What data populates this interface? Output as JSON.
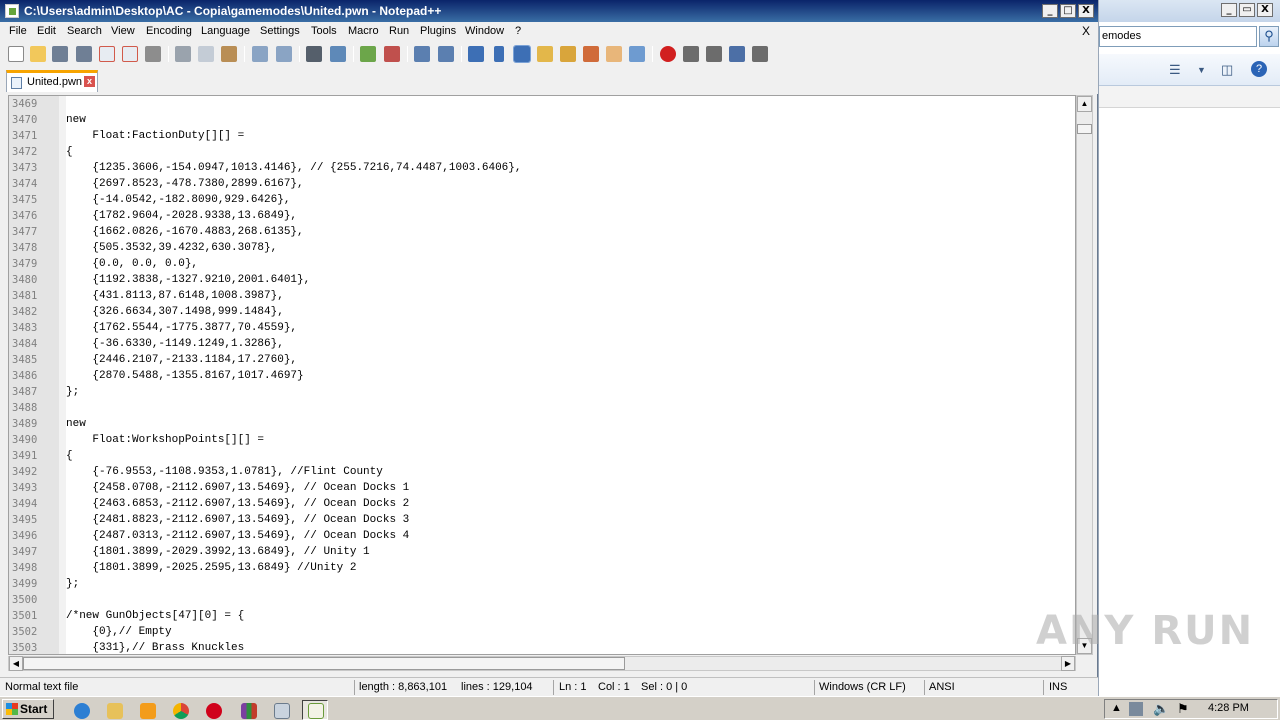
{
  "window": {
    "title": "C:\\Users\\admin\\Desktop\\AC - Copia\\gamemodes\\United.pwn - Notepad++",
    "min_label": "_",
    "max_label": "□",
    "close_label": "X"
  },
  "background_window": {
    "search_value": "emodes",
    "min_label": "_",
    "restore_label": "▭",
    "close_label": "X"
  },
  "menu": {
    "items": [
      "File",
      "Edit",
      "Search",
      "View",
      "Encoding",
      "Language",
      "Settings",
      "Tools",
      "Macro",
      "Run",
      "Plugins",
      "Window",
      "?"
    ],
    "close_label": "X"
  },
  "tab": {
    "label": "United.pwn",
    "close_label": "x"
  },
  "editor": {
    "lines": [
      {
        "n": "3469",
        "t": ""
      },
      {
        "n": "3470",
        "t": "new"
      },
      {
        "n": "3471",
        "t": "    Float:FactionDuty[][] ="
      },
      {
        "n": "3472",
        "t": "{"
      },
      {
        "n": "3473",
        "t": "    {1235.3606,-154.0947,1013.4146}, // {255.7216,74.4487,1003.6406},"
      },
      {
        "n": "3474",
        "t": "    {2697.8523,-478.7380,2899.6167},"
      },
      {
        "n": "3475",
        "t": "    {-14.0542,-182.8090,929.6426},"
      },
      {
        "n": "3476",
        "t": "    {1782.9604,-2028.9338,13.6849},"
      },
      {
        "n": "3477",
        "t": "    {1662.0826,-1670.4883,268.6135},"
      },
      {
        "n": "3478",
        "t": "    {505.3532,39.4232,630.3078},"
      },
      {
        "n": "3479",
        "t": "    {0.0, 0.0, 0.0},"
      },
      {
        "n": "3480",
        "t": "    {1192.3838,-1327.9210,2001.6401},"
      },
      {
        "n": "3481",
        "t": "    {431.8113,87.6148,1008.3987},"
      },
      {
        "n": "3482",
        "t": "    {326.6634,307.1498,999.1484},"
      },
      {
        "n": "3483",
        "t": "    {1762.5544,-1775.3877,70.4559},"
      },
      {
        "n": "3484",
        "t": "    {-36.6330,-1149.1249,1.3286},"
      },
      {
        "n": "3485",
        "t": "    {2446.2107,-2133.1184,17.2760},"
      },
      {
        "n": "3486",
        "t": "    {2870.5488,-1355.8167,1017.4697}"
      },
      {
        "n": "3487",
        "t": "};"
      },
      {
        "n": "3488",
        "t": ""
      },
      {
        "n": "3489",
        "t": "new"
      },
      {
        "n": "3490",
        "t": "    Float:WorkshopPoints[][] ="
      },
      {
        "n": "3491",
        "t": "{"
      },
      {
        "n": "3492",
        "t": "    {-76.9553,-1108.9353,1.0781}, //Flint County"
      },
      {
        "n": "3493",
        "t": "    {2458.0708,-2112.6907,13.5469}, // Ocean Docks 1"
      },
      {
        "n": "3494",
        "t": "    {2463.6853,-2112.6907,13.5469}, // Ocean Docks 2"
      },
      {
        "n": "3495",
        "t": "    {2481.8823,-2112.6907,13.5469}, // Ocean Docks 3"
      },
      {
        "n": "3496",
        "t": "    {2487.0313,-2112.6907,13.5469}, // Ocean Docks 4"
      },
      {
        "n": "3497",
        "t": "    {1801.3899,-2029.3992,13.6849}, // Unity 1"
      },
      {
        "n": "3498",
        "t": "    {1801.3899,-2025.2595,13.6849} //Unity 2"
      },
      {
        "n": "3499",
        "t": "};"
      },
      {
        "n": "3500",
        "t": ""
      },
      {
        "n": "3501",
        "t": "/*new GunObjects[47][0] = {"
      },
      {
        "n": "3502",
        "t": "    {0},// Empty"
      },
      {
        "n": "3503",
        "t": "    {331},// Brass Knuckles"
      }
    ]
  },
  "statusbar": {
    "filetype": "Normal text file",
    "length": "length : 8,863,101",
    "lines": "lines : 129,104",
    "ln": "Ln : 1",
    "col": "Col : 1",
    "sel": "Sel : 0 | 0",
    "eol": "Windows (CR LF)",
    "encoding": "ANSI",
    "mode": "INS"
  },
  "watermark": "ANY RUN",
  "taskbar": {
    "start_label": "Start",
    "clock": "4:28 PM",
    "apps": [
      "ie-icon",
      "explorer-icon",
      "media-player-icon",
      "chrome-icon",
      "opera-icon",
      "winrar-icon",
      "window-icon",
      "notepadpp-icon"
    ]
  }
}
